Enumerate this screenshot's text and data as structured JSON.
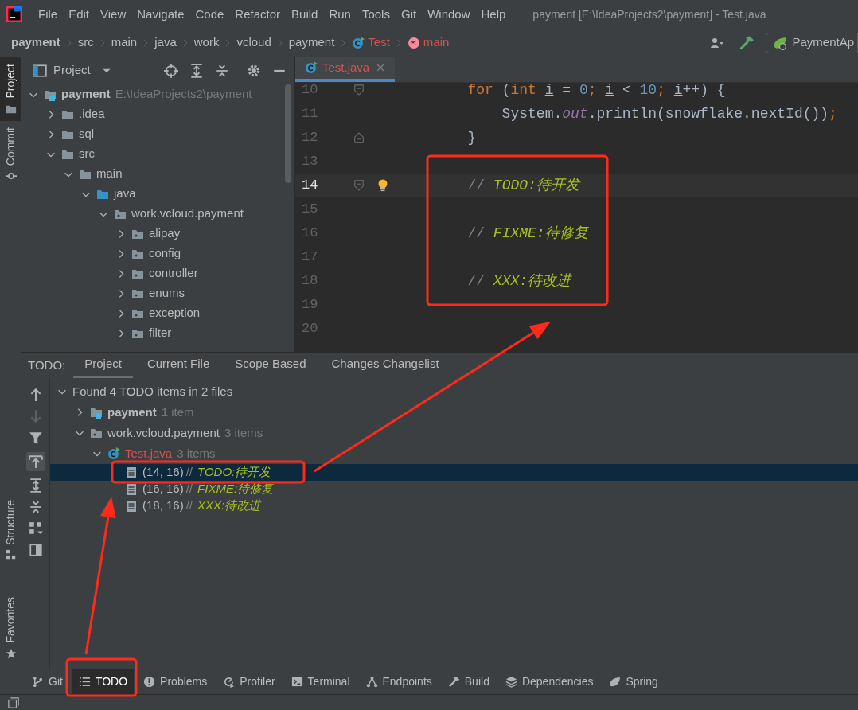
{
  "menu_bar": {
    "items": [
      "File",
      "Edit",
      "View",
      "Navigate",
      "Code",
      "Refactor",
      "Build",
      "Run",
      "Tools",
      "Git",
      "Window",
      "Help"
    ],
    "title": "payment [E:\\IdeaProjects2\\payment] - Test.java"
  },
  "breadcrumbs": [
    {
      "label": "payment",
      "kind": "project"
    },
    {
      "label": "src",
      "kind": "folder"
    },
    {
      "label": "main",
      "kind": "folder"
    },
    {
      "label": "java",
      "kind": "folder"
    },
    {
      "label": "work",
      "kind": "folder"
    },
    {
      "label": "vcloud",
      "kind": "folder"
    },
    {
      "label": "payment",
      "kind": "folder"
    },
    {
      "label": "Test",
      "kind": "class"
    },
    {
      "label": "main",
      "kind": "method"
    }
  ],
  "run_config": {
    "label": "PaymentAp"
  },
  "side_strip": {
    "top": [
      {
        "label": "Project",
        "selected": true
      },
      {
        "label": "Commit",
        "selected": false
      }
    ],
    "bottom": [
      {
        "label": "Structure"
      },
      {
        "label": "Favorites"
      }
    ]
  },
  "project_panel": {
    "title": "Project",
    "tree": [
      {
        "label": "payment",
        "path": "E:\\IdeaProjects2\\payment",
        "kind": "module",
        "expanded": true,
        "children": [
          {
            "label": ".idea",
            "kind": "folder",
            "expanded": false
          },
          {
            "label": "sql",
            "kind": "folder",
            "expanded": false
          },
          {
            "label": "src",
            "kind": "folder",
            "expanded": true,
            "children": [
              {
                "label": "main",
                "kind": "folder",
                "expanded": true,
                "children": [
                  {
                    "label": "java",
                    "kind": "source_root",
                    "expanded": true,
                    "children": [
                      {
                        "label": "work.vcloud.payment",
                        "kind": "package",
                        "expanded": true,
                        "children": [
                          {
                            "label": "alipay",
                            "kind": "package",
                            "expanded": false
                          },
                          {
                            "label": "config",
                            "kind": "package",
                            "expanded": false
                          },
                          {
                            "label": "controller",
                            "kind": "package",
                            "expanded": false
                          },
                          {
                            "label": "enums",
                            "kind": "package",
                            "expanded": false
                          },
                          {
                            "label": "exception",
                            "kind": "package",
                            "expanded": false
                          },
                          {
                            "label": "filter",
                            "kind": "package",
                            "expanded": false
                          }
                        ]
                      }
                    ]
                  }
                ]
              }
            ]
          }
        ]
      }
    ]
  },
  "editor": {
    "tabs": [
      {
        "label": "Test.java",
        "selected": true
      }
    ],
    "lines": [
      {
        "number": "10",
        "fold_start": true,
        "tokens": [
          {
            "kind": "keyword",
            "text": "        for"
          },
          {
            "kind": "plain",
            "text": " ("
          },
          {
            "kind": "keyword",
            "text": "int "
          },
          {
            "kind": "var",
            "text": "i"
          },
          {
            "kind": "plain",
            "text": " = "
          },
          {
            "kind": "number",
            "text": "0"
          },
          {
            "kind": "keyword",
            "text": "; "
          },
          {
            "kind": "var",
            "text": "i"
          },
          {
            "kind": "plain",
            "text": " < "
          },
          {
            "kind": "number",
            "text": "10"
          },
          {
            "kind": "keyword",
            "text": "; "
          },
          {
            "kind": "var",
            "text": "i"
          },
          {
            "kind": "plain",
            "text": "++) {"
          }
        ]
      },
      {
        "number": "11",
        "tokens": [
          {
            "kind": "plain",
            "text": "            System."
          },
          {
            "kind": "field",
            "text": "out"
          },
          {
            "kind": "plain",
            "text": ".println(snowflake.nextId())"
          },
          {
            "kind": "keyword",
            "text": ";"
          }
        ]
      },
      {
        "number": "12",
        "fold_end": true,
        "tokens": [
          {
            "kind": "plain",
            "text": "        }"
          }
        ]
      },
      {
        "number": "13"
      },
      {
        "number": "14",
        "fold_start": true,
        "current": true,
        "bulb": true,
        "tokens": [
          {
            "kind": "comment",
            "text": "        // "
          },
          {
            "kind": "todo",
            "text": "TODO:待开发"
          }
        ]
      },
      {
        "number": "15"
      },
      {
        "number": "16",
        "tokens": [
          {
            "kind": "comment",
            "text": "        // "
          },
          {
            "kind": "todo",
            "text": "FIXME:待修复"
          }
        ]
      },
      {
        "number": "17"
      },
      {
        "number": "18",
        "tokens": [
          {
            "kind": "comment",
            "text": "        // "
          },
          {
            "kind": "todo",
            "text": "XXX:待改进"
          }
        ]
      },
      {
        "number": "19"
      },
      {
        "number": "20"
      }
    ]
  },
  "todo_panel": {
    "label": "TODO:",
    "tabs": [
      {
        "label": "Project",
        "selected": true
      },
      {
        "label": "Current File",
        "selected": false
      },
      {
        "label": "Scope Based",
        "selected": false
      },
      {
        "label": "Changes Changelist",
        "selected": false
      }
    ],
    "tree": [
      {
        "label": "Found 4 TODO items in 2 files",
        "expanded": true,
        "children": [
          {
            "label": "payment",
            "kind": "module",
            "count": "1 item",
            "expanded": false
          },
          {
            "label": "work.vcloud.payment",
            "kind": "package",
            "count": "3 items",
            "expanded": true,
            "children": [
              {
                "label": "Test.java",
                "kind": "class",
                "count": "3 items",
                "expanded": true,
                "children": [
                  {
                    "kind": "todo",
                    "position": "(14, 16)",
                    "comment": "//",
                    "text": "TODO:待开发",
                    "selected": true
                  },
                  {
                    "kind": "todo",
                    "position": "(16, 16)",
                    "comment": "//",
                    "text": "FIXME:待修复",
                    "selected": false
                  },
                  {
                    "kind": "todo",
                    "position": "(18, 16)",
                    "comment": "//",
                    "text": "XXX:待改进",
                    "selected": false
                  }
                ]
              }
            ]
          }
        ]
      }
    ]
  },
  "tool_bar": [
    {
      "label": "Git",
      "kind": "git",
      "selected": false
    },
    {
      "label": "TODO",
      "kind": "list",
      "selected": true
    },
    {
      "label": "Problems",
      "kind": "problems",
      "selected": false
    },
    {
      "label": "Profiler",
      "kind": "profiler",
      "selected": false
    },
    {
      "label": "Terminal",
      "kind": "terminal",
      "selected": false
    },
    {
      "label": "Endpoints",
      "kind": "endpoints",
      "selected": false
    },
    {
      "label": "Build",
      "kind": "build",
      "selected": false
    },
    {
      "label": "Dependencies",
      "kind": "dependencies",
      "selected": false
    },
    {
      "label": "Spring",
      "kind": "spring",
      "selected": false
    }
  ]
}
